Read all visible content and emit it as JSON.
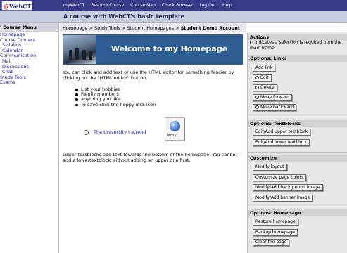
{
  "app": {
    "logo_text_a": "@",
    "logo_text_b": "WebCT"
  },
  "topnav": {
    "items": [
      "myWebCT",
      "Resume Course",
      "Course Map",
      "Check Browser",
      "Log Out",
      "Help"
    ]
  },
  "course": {
    "title": "A course with WebCT's basic template"
  },
  "sidebar": {
    "header": "' Course Menu",
    "items": [
      {
        "label": "Homepage",
        "indent": 0
      },
      {
        "label": "Course Content",
        "indent": 0
      },
      {
        "label": "Syllabus",
        "indent": 1
      },
      {
        "label": "Calendar",
        "indent": 1
      },
      {
        "label": "Communication",
        "indent": 0
      },
      {
        "label": "Mail",
        "indent": 1
      },
      {
        "label": "Discussions",
        "indent": 1
      },
      {
        "label": "Chat",
        "indent": 1
      },
      {
        "label": "Study Tools",
        "indent": 0
      },
      {
        "label": "Exams",
        "indent": 0
      }
    ]
  },
  "breadcrumb": {
    "items": [
      "Homepage",
      "Study Tools",
      "Student Homepages"
    ],
    "current": "Student Demo Account",
    "separator": ">"
  },
  "main": {
    "banner_title": "Welcome to my Homepage",
    "intro": "You can click and add text or use the HTML editor for something fancier by clicking on the \"HTML editor\" button.",
    "bullets": [
      "List your hobbies",
      "Family members",
      "anything you like",
      "To save click the floppy disk icon"
    ],
    "link_text": "The University I attend",
    "http_icon_label": "http://",
    "footer_note": "Lower textblocks add text towards the bottom of the homepage. You cannot add a lowertextblock without adding an upper one first."
  },
  "panel": {
    "actions_title": "Actions",
    "actions_note": "indicates a selection is required from the main frame.",
    "links_title": "Options: Links",
    "links_buttons": [
      "Add link",
      "Edit",
      "Delete",
      "Move forward",
      "Move backward"
    ],
    "textblocks_title": "Options: Textblocks",
    "textblocks_buttons": [
      "Edit/Add upper textblock",
      "Edit/Add lower textblock"
    ],
    "customize_title": "Customize",
    "customize_buttons": [
      "Modify layout",
      "Customize page colors",
      "Modify/Add background image",
      "Modify/Add banner image"
    ],
    "homepage_title": "Options: Homepage",
    "homepage_buttons": [
      "Restore homepage",
      "Backup homepage",
      "Clear the page"
    ]
  },
  "colors": {
    "topbar": "#3a3a8a",
    "banner": "#2e5d94",
    "link": "#1a1aa8",
    "panel": "#e6e6e6"
  }
}
